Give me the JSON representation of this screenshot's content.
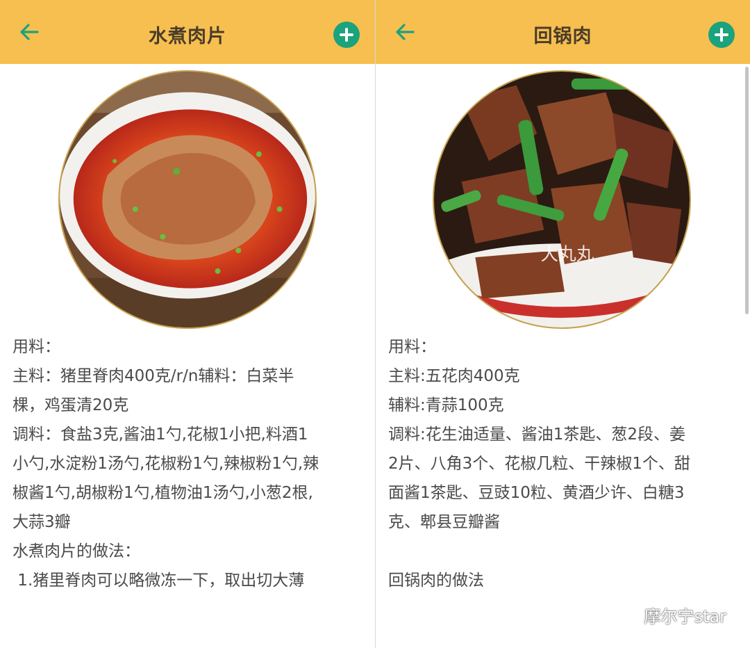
{
  "left": {
    "title": "水煮肉片",
    "photo_icon": "dish-photo",
    "lines": [
      "用料：",
      "主料：猪里脊肉400克/r/n辅料：白菜半",
      "棵，鸡蛋清20克",
      "调料：食盐3克,酱油1勺,花椒1小把,料酒1",
      "小勺,水淀粉1汤勺,花椒粉1勺,辣椒粉1勺,辣",
      "椒酱1勺,胡椒粉1勺,植物油1汤勺,小葱2根,",
      "大蒜3瓣",
      "水煮肉片的做法：",
      " 1.猪里脊肉可以略微冻一下，取出切大薄"
    ]
  },
  "right": {
    "title": "回锅肉",
    "photo_icon": "dish-photo",
    "photo_watermark": "大丸丸",
    "lines": [
      "用料：",
      "主料:五花肉400克",
      "辅料:青蒜100克",
      "调料:花生油适量、酱油1茶匙、葱2段、姜",
      "2片、八角3个、花椒几粒、干辣椒1个、甜",
      "面酱1茶匙、豆豉10粒、黄酒少许、白糖3",
      "克、郫县豆瓣酱"
    ],
    "method_title": "回锅肉的做法"
  },
  "watermark": "摩尔宁star",
  "icons": {
    "back": "arrow-left-icon",
    "add": "plus-circle-icon",
    "wechat": "wechat-icon"
  },
  "colors": {
    "appbar": "#f7bf4f",
    "accent": "#1aa37d",
    "text": "#4a4a4a"
  }
}
